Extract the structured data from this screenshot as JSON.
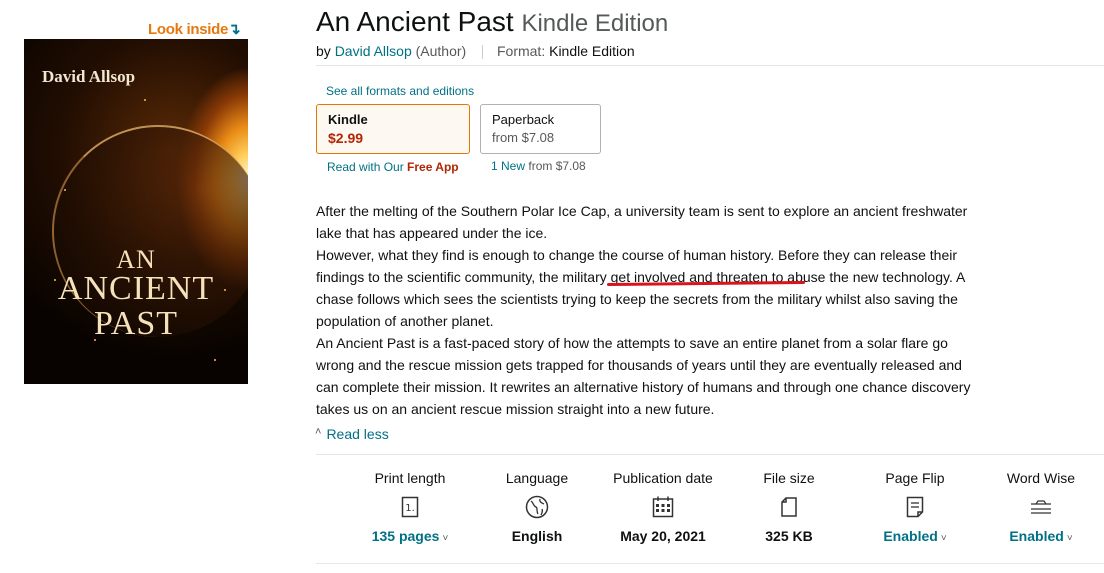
{
  "look_inside": {
    "label": "Look inside",
    "arrow": "↴"
  },
  "cover": {
    "author": "David Allsop",
    "title_lines": [
      "AN",
      "ANCIENT",
      "PAST"
    ]
  },
  "product": {
    "title": "An Ancient Past",
    "edition": "Kindle Edition",
    "by_prefix": "by",
    "author": "David Allsop",
    "author_role": "(Author)",
    "format_label": "Format:",
    "format_value": "Kindle Edition"
  },
  "formats": {
    "see_all": "See all formats and editions",
    "kindle": {
      "name": "Kindle",
      "price": "$2.99",
      "read_with": "Read with Our",
      "free_app": "Free App"
    },
    "paperback": {
      "name": "Paperback",
      "price": "from $7.08",
      "new_count": "1 New",
      "new_from": "from $7.08"
    }
  },
  "description": {
    "line1": "After the melting of the Southern Polar Ice Cap, a university team is sent to explore an ancient freshwater lake that has appeared under the ice.",
    "line2": "However, what they find is enough to change the course of human history. Before they can release their findings to the scientific community, the military get involved and threaten to abuse the new technology. A chase follows which sees the scientists trying to keep the secrets from the military whilst also saving the population of another planet.",
    "line3": "An Ancient Past is a fast-paced story of how the attempts to save an entire planet from a solar flare go wrong and the rescue mission gets trapped for thousands of years until they are eventually released and can complete their mission. It rewrites an alternative history of humans and through one chance discovery takes us on an ancient rescue mission straight into a new future.",
    "read_less": "Read less"
  },
  "attributes": [
    {
      "label": "Print length",
      "value": "135 pages",
      "icon": "print-length-icon",
      "link": true
    },
    {
      "label": "Language",
      "value": "English",
      "icon": "globe-icon",
      "link": false
    },
    {
      "label": "Publication date",
      "value": "May 20, 2021",
      "icon": "calendar-icon",
      "link": false
    },
    {
      "label": "File size",
      "value": "325 KB",
      "icon": "file-icon",
      "link": false
    },
    {
      "label": "Page Flip",
      "value": "Enabled",
      "icon": "page-flip-icon",
      "link": true
    },
    {
      "label": "Word Wise",
      "value": "Enabled",
      "icon": "word-wise-icon",
      "link": true
    }
  ],
  "colors": {
    "link": "#007185",
    "price": "#B12704",
    "accent": "#E77600",
    "annotation": "#D9141C"
  }
}
